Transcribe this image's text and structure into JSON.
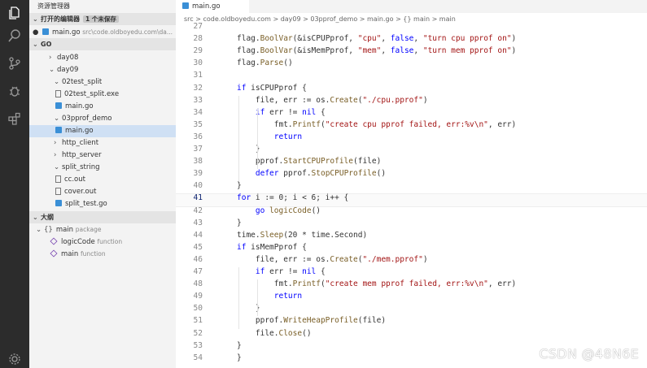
{
  "sidebar": {
    "title": "资源管理器",
    "open_editors": {
      "label": "打开的编辑器",
      "badge": "1 个未保存"
    },
    "open_file": {
      "name": "main.go",
      "path": "src\\code.oldboyedu.com\\da..."
    },
    "workspace": "GO",
    "tree": {
      "day08": "day08",
      "day09": "day09",
      "split02": "02test_split",
      "split_exe": "02test_split.exe",
      "main1": "main.go",
      "pprof": "03pprof_demo",
      "main2": "main.go",
      "http_client": "http_client",
      "http_server": "http_server",
      "split_string": "split_string",
      "cc_out": "cc.out",
      "cover_out": "cover.out",
      "split_test": "split_test.go"
    },
    "outline": {
      "title": "大纲",
      "main_pkg": "main",
      "main_pkg_type": "package",
      "logic": "logicCode",
      "logic_type": "function",
      "mainfn": "main",
      "mainfn_type": "function"
    }
  },
  "editor": {
    "tab": "main.go",
    "breadcrumb": "src > code.oldboyedu.com > day09 > 03pprof_demo > main.go > {} main > main",
    "first_line": "27",
    "lines": [
      {
        "n": "27",
        "t": ""
      },
      {
        "n": "28",
        "t": "flag.BoolVar(&isCPUPprof, \"cpu\", false, \"turn cpu pprof on\")"
      },
      {
        "n": "29",
        "t": "flag.BoolVar(&isMemPprof, \"mem\", false, \"turn mem pprof on\")"
      },
      {
        "n": "30",
        "t": "flag.Parse()"
      },
      {
        "n": "31",
        "t": ""
      },
      {
        "n": "32",
        "t": "if isCPUPprof {"
      },
      {
        "n": "33",
        "t": "    file, err := os.Create(\"./cpu.pprof\")"
      },
      {
        "n": "34",
        "t": "    if err != nil {"
      },
      {
        "n": "35",
        "t": "        fmt.Printf(\"create cpu pprof failed, err:%v\\n\", err)"
      },
      {
        "n": "36",
        "t": "        return"
      },
      {
        "n": "37",
        "t": "    }"
      },
      {
        "n": "38",
        "t": "    pprof.StartCPUProfile(file)"
      },
      {
        "n": "39",
        "t": "    defer pprof.StopCPUProfile()"
      },
      {
        "n": "40",
        "t": "}"
      },
      {
        "n": "41",
        "t": "for i := 0; i < 6; i++ {"
      },
      {
        "n": "42",
        "t": "    go logicCode()"
      },
      {
        "n": "43",
        "t": "}"
      },
      {
        "n": "44",
        "t": "time.Sleep(20 * time.Second)"
      },
      {
        "n": "45",
        "t": "if isMemPprof {"
      },
      {
        "n": "46",
        "t": "    file, err := os.Create(\"./mem.pprof\")"
      },
      {
        "n": "47",
        "t": "    if err != nil {"
      },
      {
        "n": "48",
        "t": "        fmt.Printf(\"create mem pprof failed, err:%v\\n\", err)"
      },
      {
        "n": "49",
        "t": "        return"
      },
      {
        "n": "50",
        "t": "    }"
      },
      {
        "n": "51",
        "t": "    pprof.WriteHeapProfile(file)"
      },
      {
        "n": "52",
        "t": "    file.Close()"
      },
      {
        "n": "53",
        "t": "}"
      },
      {
        "n": "54",
        "t": "}"
      }
    ],
    "active_line": "41"
  },
  "watermark": "CSDN @48N6E",
  "colors": {
    "keyword": "#0000ff",
    "string": "#a31515",
    "function": "#795e26",
    "activity_bar": "#2c2c2c",
    "sidebar": "#f3f3f3"
  }
}
